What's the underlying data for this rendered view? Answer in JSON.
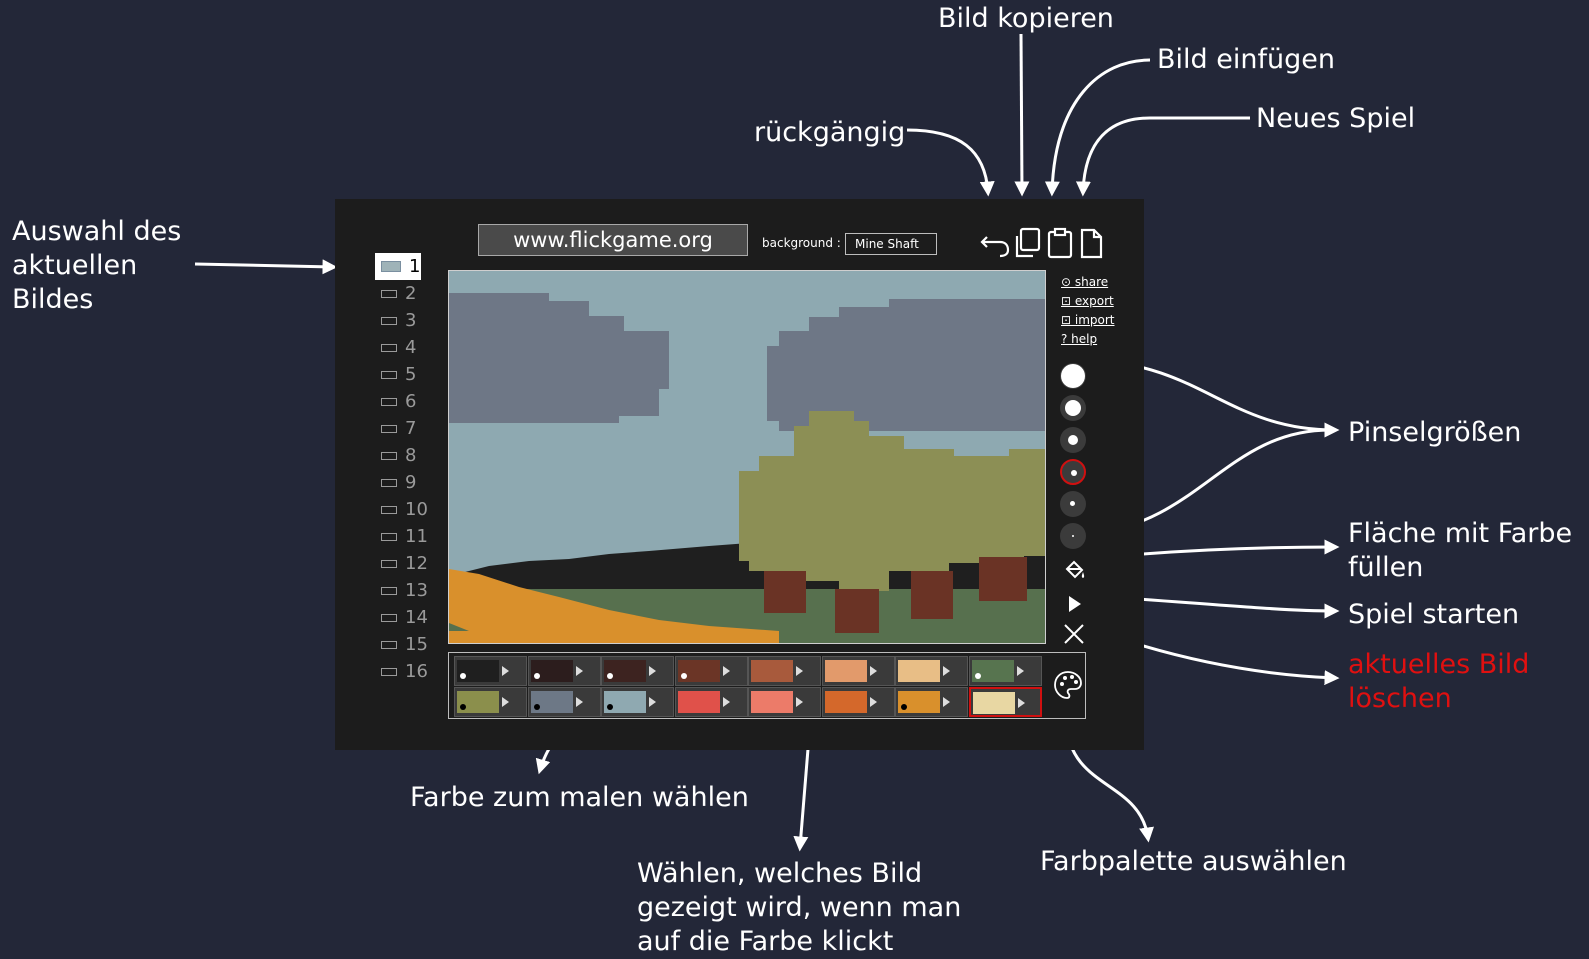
{
  "annotations": {
    "bild_kopieren": "Bild kopieren",
    "bild_einfuegen": "Bild einfügen",
    "rueckgaengig": "rückgängig",
    "neues_spiel": "Neues Spiel",
    "auswahl": "Auswahl des\naktuellen\nBildes",
    "pinselgroessen": "Pinselgrößen",
    "flaeche_fuellen": "Fläche mit Farbe\nfüllen",
    "spiel_starten": "Spiel starten",
    "bild_loeschen": "aktuelles Bild\nlöschen",
    "farbe_waehlen": "Farbe zum malen wählen",
    "bild_bei_farbe": "Wählen, welches Bild\ngezeigt wird, wenn man\nauf die Farbe klickt",
    "farbpalette": "Farbpalette auswählen"
  },
  "colors": {
    "page_bg": "#232738",
    "app_bg": "#1c1c1c",
    "delete_annotation": "#e01010",
    "selection": "#d01010"
  },
  "app": {
    "url": "www.flickgame.org",
    "background_label": "background :",
    "background_value": "Mine Shaft",
    "toolbar_icons": [
      "undo-icon",
      "copy-icon",
      "paste-icon",
      "new-page-icon"
    ],
    "frames": [
      "1",
      "2",
      "3",
      "4",
      "5",
      "6",
      "7",
      "8",
      "9",
      "10",
      "11",
      "12",
      "13",
      "14",
      "15",
      "16"
    ],
    "selected_frame": "1",
    "side_links": [
      "⊙ share",
      "⊡ export",
      "⊡ import",
      "? help"
    ],
    "brush_sizes_selected_index": 3,
    "side_tool_icons": [
      "fill-bucket-icon",
      "play-icon",
      "clear-x-icon"
    ],
    "palette": {
      "row1": [
        "#1f1f1f",
        "#2c1d1d",
        "#3d2320",
        "#6b3526",
        "#a85a3c",
        "#e29a6b",
        "#e8be86",
        "#57744f"
      ],
      "row2": [
        "#8b8f4c",
        "#6d7886",
        "#8fa9b1",
        "#e0514a",
        "#ec7b69",
        "#d4682b",
        "#d9902c",
        "#e8d7a3"
      ],
      "selected": "row2-7",
      "palette_icon": "palette-icon"
    },
    "canvas_colors": {
      "sky": "#8ea9b1",
      "cloud": "#6e7786",
      "tree_foliage": "#8c8f55",
      "trunk": "#6a3325",
      "ground": "#57704e",
      "path": "#d9902c",
      "dark_hill": "#1f1f1f"
    }
  }
}
